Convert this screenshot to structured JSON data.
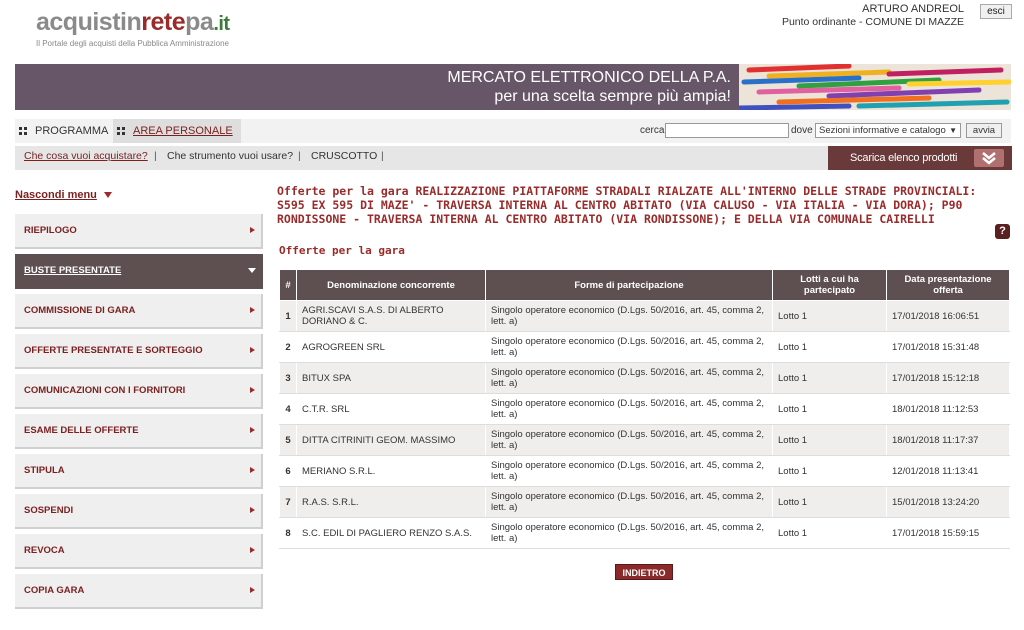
{
  "header": {
    "logo": {
      "part1": "acquistin",
      "part2": "rete",
      "part3": "pa",
      "part4": ".it",
      "tagline": "Il Portale degli acquisti della Pubblica Amministrazione"
    },
    "user": {
      "name": "ARTURO ANDREOL",
      "role": "Punto ordinante - COMUNE DI MAZZE"
    },
    "logout_label": "esci"
  },
  "banner": {
    "line1": "MERCATO ELETTRONICO DELLA P.A.",
    "line2": "per una scelta sempre più ampia!"
  },
  "nav": {
    "tabs": [
      {
        "label": "PROGRAMMA"
      },
      {
        "label": "AREA PERSONALE"
      }
    ],
    "search": {
      "label": "cerca",
      "value": "",
      "where_label": "dove",
      "where_value": "Sezioni informative e catalogo",
      "go_label": "avvia"
    }
  },
  "subnav": {
    "items": [
      {
        "label": "Che cosa vuoi acquistare?"
      },
      {
        "label": "Che strumento vuoi usare?"
      },
      {
        "label": "CRUSCOTTO"
      }
    ],
    "separator": "|",
    "download_label": "Scarica elenco prodotti"
  },
  "sidebar": {
    "hide_label": "Nascondi menu",
    "items": [
      {
        "label": "RIEPILOGO",
        "active": false
      },
      {
        "label": "BUSTE PRESENTATE",
        "active": true
      },
      {
        "label": "COMMISSIONE DI GARA",
        "active": false
      },
      {
        "label": "OFFERTE PRESENTATE E SORTEGGIO",
        "active": false
      },
      {
        "label": "COMUNICAZIONI CON I FORNITORI",
        "active": false
      },
      {
        "label": "ESAME DELLE OFFERTE",
        "active": false
      },
      {
        "label": "STIPULA",
        "active": false
      },
      {
        "label": "SOSPENDI",
        "active": false
      },
      {
        "label": "REVOCA",
        "active": false
      },
      {
        "label": "COPIA GARA",
        "active": false
      }
    ]
  },
  "main": {
    "title": "Offerte per la gara REALIZZAZIONE PIATTAFORME STRADALI RIALZATE ALL'INTERNO DELLE STRADE PROVINCIALI: S595 EX 595 DI MAZE' - TRAVERSA INTERNA AL CENTRO ABITATO (VIA CALUSO - VIA ITALIA - VIA DORA); P90 RONDISSONE - TRAVERSA INTERNA AL CENTRO ABITATO (VIA RONDISSONE); E DELLA VIA COMUNALE CAIRELLI",
    "help_label": "?",
    "subtitle": "Offerte per la gara",
    "table": {
      "headers": [
        "#",
        "Denominazione concorrente",
        "Forme di partecipazione",
        "Lotti a cui ha partecipato",
        "Data presentazione offerta"
      ],
      "rows": [
        {
          "n": "1",
          "name": "AGRI.SCAVI S.A.S. DI ALBERTO DORIANO & C.",
          "form": "Singolo operatore economico (D.Lgs. 50/2016, art. 45, comma 2, lett. a)",
          "lot": "Lotto 1",
          "date": "17/01/2018 16:06:51"
        },
        {
          "n": "2",
          "name": "AGROGREEN SRL",
          "form": "Singolo operatore economico (D.Lgs. 50/2016, art. 45, comma 2, lett. a)",
          "lot": "Lotto 1",
          "date": "17/01/2018 15:31:48"
        },
        {
          "n": "3",
          "name": "BITUX SPA",
          "form": "Singolo operatore economico (D.Lgs. 50/2016, art. 45, comma 2, lett. a)",
          "lot": "Lotto 1",
          "date": "17/01/2018 15:12:18"
        },
        {
          "n": "4",
          "name": "C.T.R. SRL",
          "form": "Singolo operatore economico (D.Lgs. 50/2016, art. 45, comma 2, lett. a)",
          "lot": "Lotto 1",
          "date": "18/01/2018 11:12:53"
        },
        {
          "n": "5",
          "name": "DITTA CITRINITI GEOM. MASSIMO",
          "form": "Singolo operatore economico (D.Lgs. 50/2016, art. 45, comma 2, lett. a)",
          "lot": "Lotto 1",
          "date": "18/01/2018 11:17:37"
        },
        {
          "n": "6",
          "name": "MERIANO S.R.L.",
          "form": "Singolo operatore economico (D.Lgs. 50/2016, art. 45, comma 2, lett. a)",
          "lot": "Lotto 1",
          "date": "12/01/2018 11:13:41"
        },
        {
          "n": "7",
          "name": "R.A.S. S.R.L.",
          "form": "Singolo operatore economico (D.Lgs. 50/2016, art. 45, comma 2, lett. a)",
          "lot": "Lotto 1",
          "date": "15/01/2018 13:24:20"
        },
        {
          "n": "8",
          "name": "S.C. EDIL DI PAGLIERO RENZO S.A.S.",
          "form": "Singolo operatore economico (D.Lgs. 50/2016, art. 45, comma 2, lett. a)",
          "lot": "Lotto 1",
          "date": "17/01/2018 15:59:15"
        }
      ]
    },
    "back_label": "INDIETRO"
  },
  "colors": {
    "brand": "#9a2b2b",
    "banner": "#675668",
    "table_header": "#5e5050",
    "active_menu": "#5e5050"
  },
  "icons": {
    "help": "question-icon",
    "menu_arrow": "caret-right-icon",
    "download": "double-chevron-down-icon"
  }
}
